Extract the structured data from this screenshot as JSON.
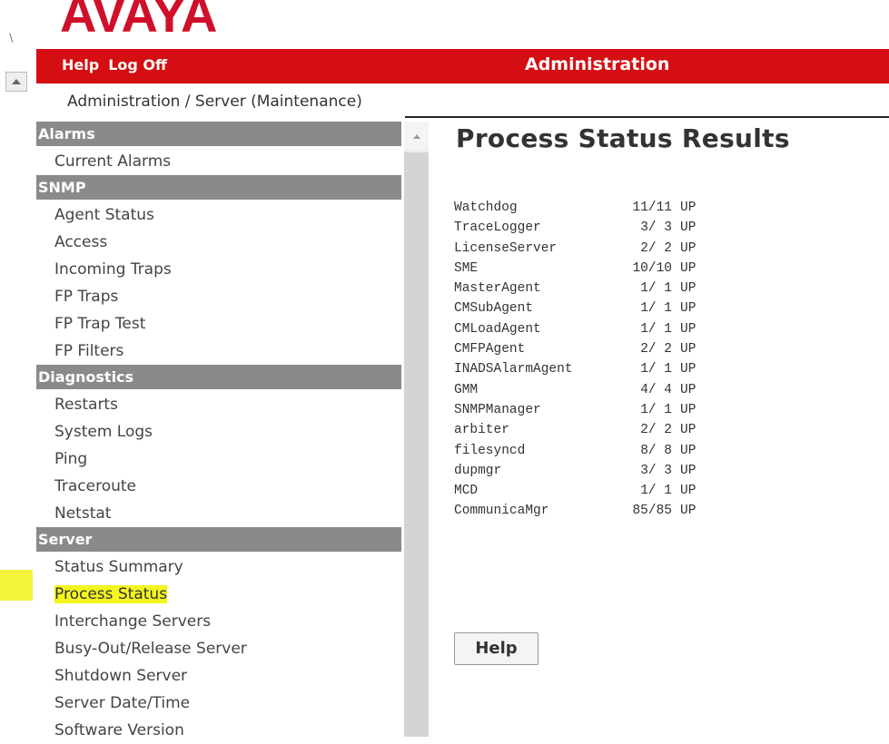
{
  "brand": {
    "logo_text": "AVAYA",
    "color": "#d0102a"
  },
  "topbar": {
    "links": [
      {
        "label": "Help"
      },
      {
        "label": "Log Off"
      }
    ],
    "title": "Administration",
    "color": "#d40e12"
  },
  "breadcrumb": "Administration / Server (Maintenance)",
  "sidebar": {
    "groups": [
      {
        "header": "Alarms",
        "items": [
          "Current Alarms"
        ]
      },
      {
        "header": "SNMP",
        "items": [
          "Agent Status",
          "Access",
          "Incoming Traps",
          "FP Traps",
          "FP Trap Test",
          "FP Filters"
        ]
      },
      {
        "header": "Diagnostics",
        "items": [
          "Restarts",
          "System Logs",
          "Ping",
          "Traceroute",
          "Netstat"
        ]
      },
      {
        "header": "Server",
        "items": [
          "Status Summary",
          "Process Status",
          "Interchange Servers",
          "Busy-Out/Release Server",
          "Shutdown Server",
          "Server Date/Time",
          "Software Version"
        ]
      }
    ],
    "selected_item": "Process Status",
    "highlight_color": "#f5f520"
  },
  "main": {
    "title": "Process Status Results",
    "processes": [
      {
        "name": "Watchdog",
        "count": "11/11",
        "state": "UP"
      },
      {
        "name": "TraceLogger",
        "count": "3/ 3",
        "state": "UP"
      },
      {
        "name": "LicenseServer",
        "count": "2/ 2",
        "state": "UP"
      },
      {
        "name": "SME",
        "count": "10/10",
        "state": "UP"
      },
      {
        "name": "MasterAgent",
        "count": "1/ 1",
        "state": "UP"
      },
      {
        "name": "CMSubAgent",
        "count": "1/ 1",
        "state": "UP"
      },
      {
        "name": "CMLoadAgent",
        "count": "1/ 1",
        "state": "UP"
      },
      {
        "name": "CMFPAgent",
        "count": "2/ 2",
        "state": "UP"
      },
      {
        "name": "INADSAlarmAgent",
        "count": "1/ 1",
        "state": "UP"
      },
      {
        "name": "GMM",
        "count": "4/ 4",
        "state": "UP"
      },
      {
        "name": "SNMPManager",
        "count": "1/ 1",
        "state": "UP"
      },
      {
        "name": "arbiter",
        "count": "2/ 2",
        "state": "UP"
      },
      {
        "name": "filesyncd",
        "count": "8/ 8",
        "state": "UP"
      },
      {
        "name": "dupmgr",
        "count": "3/ 3",
        "state": "UP"
      },
      {
        "name": "MCD",
        "count": "1/ 1",
        "state": "UP"
      },
      {
        "name": "CommunicaMgr",
        "count": "85/85",
        "state": "UP"
      }
    ],
    "help_button": "Help"
  },
  "icons": {
    "scroll_up": "triangle-up-icon",
    "resize_handle": "resize-handle-icon"
  }
}
